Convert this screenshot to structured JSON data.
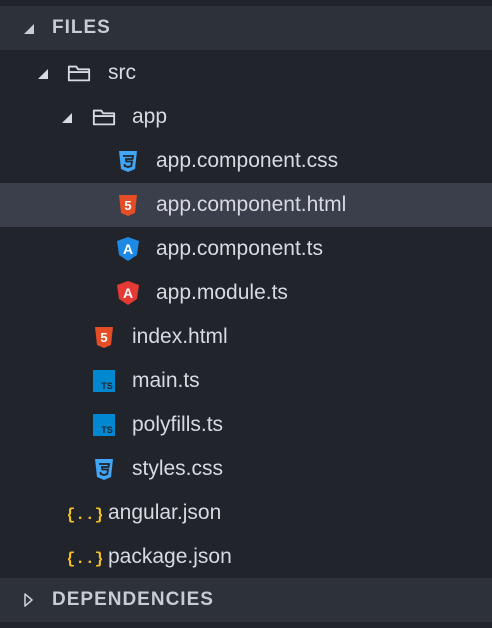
{
  "files_header": {
    "label": "FILES"
  },
  "dependencies_header": {
    "label": "DEPENDENCIES"
  },
  "tree": {
    "src": "src",
    "app": "app",
    "app_component_css": "app.component.css",
    "app_component_html": "app.component.html",
    "app_component_ts": "app.component.ts",
    "app_module_ts": "app.module.ts",
    "index_html": "index.html",
    "main_ts": "main.ts",
    "polyfills_ts": "polyfills.ts",
    "styles_css": "styles.css",
    "angular_json": "angular.json",
    "package_json": "package.json"
  },
  "icons": {
    "ts_badge": "TS",
    "html_badge": "5",
    "angular_badge": "A",
    "json_badge": "{..}"
  },
  "colors": {
    "css": "#42a5f5",
    "html": "#e44d26",
    "angular_blue": "#1e88e5",
    "angular_red": "#e53935",
    "ts": "#0288d1",
    "json": "#f5c125",
    "selected_row": "#3a3f4b"
  }
}
